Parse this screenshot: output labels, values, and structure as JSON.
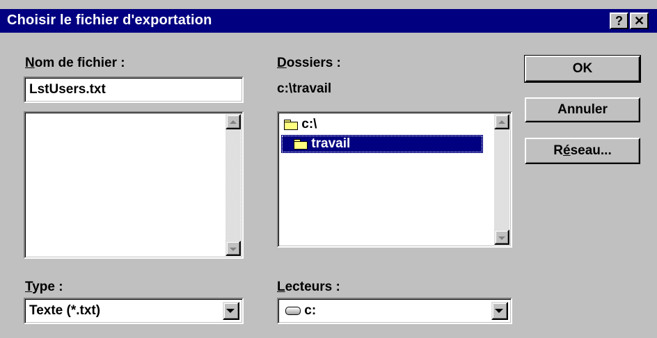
{
  "window": {
    "title": "Choisir le fichier d'exportation",
    "help_button": "?",
    "close_button": "✕"
  },
  "filename": {
    "label": "Nom de fichier :",
    "value": "LstUsers.txt",
    "files": []
  },
  "folders": {
    "label": "Dossiers :",
    "current_path": "c:\\travail",
    "items": [
      {
        "name": "c:\\",
        "icon": "folder-open-icon",
        "selected": false
      },
      {
        "name": "travail",
        "icon": "folder-open-icon",
        "selected": true
      }
    ]
  },
  "type": {
    "label": "Type :",
    "selected": "Texte (*.txt)"
  },
  "drives": {
    "label": "Lecteurs :",
    "selected": "c:",
    "icon": "drive-icon"
  },
  "buttons": {
    "ok": "OK",
    "cancel": "Annuler",
    "network": "Réseau..."
  },
  "colors": {
    "titlebar": "#000080",
    "face": "#c0c0c0",
    "selection": "#000080"
  }
}
